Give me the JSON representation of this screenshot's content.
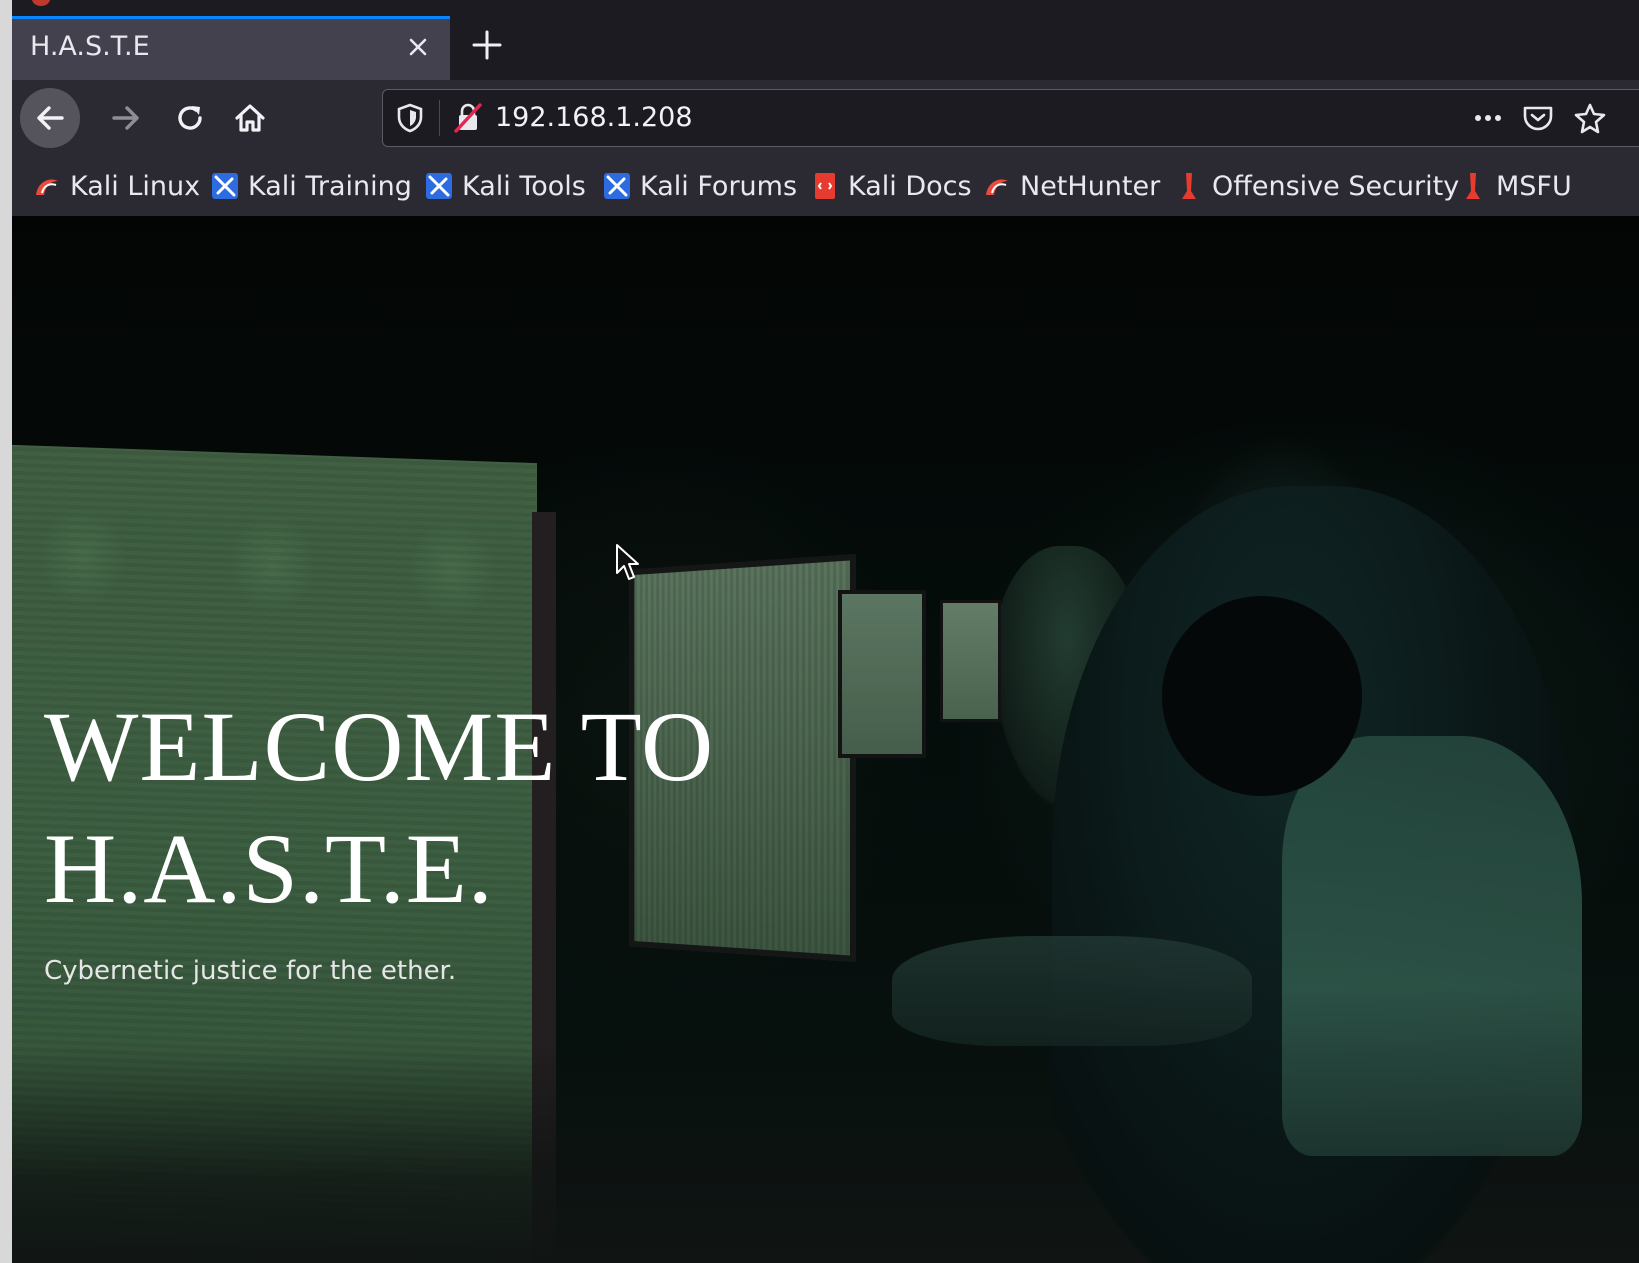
{
  "browser": {
    "tab": {
      "title": "H.A.S.T.E"
    },
    "address_bar": {
      "url": "192.168.1.208"
    },
    "bookmarks": [
      {
        "label": "Kali Linux",
        "icon": "kali-dragon-icon"
      },
      {
        "label": "Kali Training",
        "icon": "kali-sword-icon"
      },
      {
        "label": "Kali Tools",
        "icon": "kali-sword-icon"
      },
      {
        "label": "Kali Forums",
        "icon": "kali-sword-icon"
      },
      {
        "label": "Kali Docs",
        "icon": "kali-docs-icon"
      },
      {
        "label": "NetHunter",
        "icon": "kali-dragon-icon"
      },
      {
        "label": "Offensive Security",
        "icon": "offsec-icon"
      },
      {
        "label": "MSFU",
        "icon": "offsec-icon"
      }
    ]
  },
  "page": {
    "hero": {
      "title_line1": "WELCOME TO",
      "title_line2": "H.A.S.T.E.",
      "subtitle": "Cybernetic justice for the ether."
    }
  },
  "colors": {
    "tab_accent": "#0a84ff",
    "toolbar_bg": "#2b2a33",
    "tabstrip_bg": "#1c1b22",
    "hero_text": "#ffffff"
  }
}
